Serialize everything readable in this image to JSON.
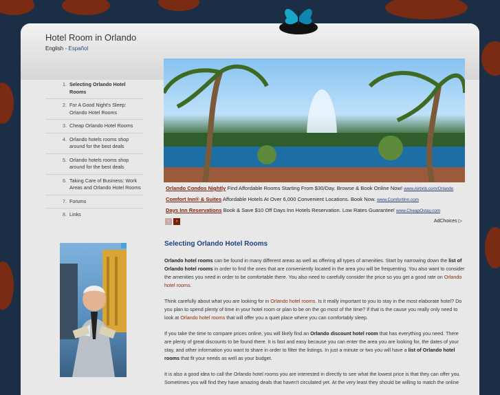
{
  "site": {
    "title": "Hotel Room in Orlando"
  },
  "lang": {
    "english": "English",
    "sep": " - ",
    "spanish": "Español"
  },
  "sidebar": {
    "items": [
      {
        "num": "1.",
        "label": "Selecting Orlando Hotel Rooms"
      },
      {
        "num": "2.",
        "label": "For A Good Night's Sleep: Orlando Hotel Rooms"
      },
      {
        "num": "3.",
        "label": "Cheap Orlando Hotel Rooms"
      },
      {
        "num": "4.",
        "label": "Orlando hotels rooms shop around for the best deals"
      },
      {
        "num": "5.",
        "label": "Orlando hotels rooms shop around for the best deals"
      },
      {
        "num": "6.",
        "label": "Taking Care of Business: Work Areas and Orlando Hotel Rooms"
      },
      {
        "num": "7.",
        "label": "Forums"
      },
      {
        "num": "8.",
        "label": "Links"
      }
    ]
  },
  "ads": [
    {
      "title": "Orlando Condos Nightly",
      "text": " Find Affordable Rooms Starting From $30/Day. Browse & Book Online Now! ",
      "url": "www.Airbnb.com/Orlando"
    },
    {
      "title": "Comfort Inn® & Suites",
      "text": " Affordable Hotels At Over 6,000 Convenient Locations. Book Now. ",
      "url": "www.ComfortInn.com"
    },
    {
      "title": "Days Inn Reservations",
      "text": " Book & Save $10 Off Days Inn Hotels Reservation. Low Rates Guarantee! ",
      "url": "www.CheapOstay.com"
    }
  ],
  "adchoices": "AdChoices ▷",
  "nav": {
    "prev": "‹",
    "next": "›"
  },
  "post": {
    "title": "Selecting Orlando Hotel Rooms",
    "p1": [
      "Orlando hotel rooms",
      " can be found in many different areas as well as offering all types of amenities. Start by narrowing down the ",
      "list of Orlando hotel rooms",
      " in order to find the ones that are conveniently located in the area you will be frequenting. You also want to consider the amenities you need in order to be comfortable there. You also need to carefully consider the price so you get a good rate on ",
      "Orlando hotel rooms",
      "."
    ],
    "p2": [
      "Think carefully about what you are looking for in ",
      "Orlando hotel rooms",
      ". Is it really important to you to stay in the most elaborate hotel? Do you plan to spend plenty of time in your hotel room or plan to be on the go most of the time? If that is the cause you really only need to look at ",
      "Orlando hotel rooms",
      " that will offer you a quiet place where you can comfortably sleep."
    ],
    "p3": [
      "If you take the time to compare prices online, you will likely find an ",
      "Orlando discount hotel room",
      " that has everything you need. There are plenty of great discounts to be found there. It is fast and easy because you can enter the area you are looking for, the dates of your stay, and other information you want to share in order to filter the listings. In just a minute or two you will have a ",
      "list of Orlando hotel rooms",
      " that fit your needs as well as your budget."
    ],
    "p4": [
      "It is also a good idea to call the Orlando hotel rooms you are interested in directly to see what the lowest price is that they can offer you. Sometimes you will find they have amazing deals that haven't circulated yet. At the very least they should be willing to match the online"
    ]
  },
  "colors": {
    "background": "#1c2e45",
    "accent_red": "#8a2a0a",
    "title_blue": "#1e3f80"
  }
}
